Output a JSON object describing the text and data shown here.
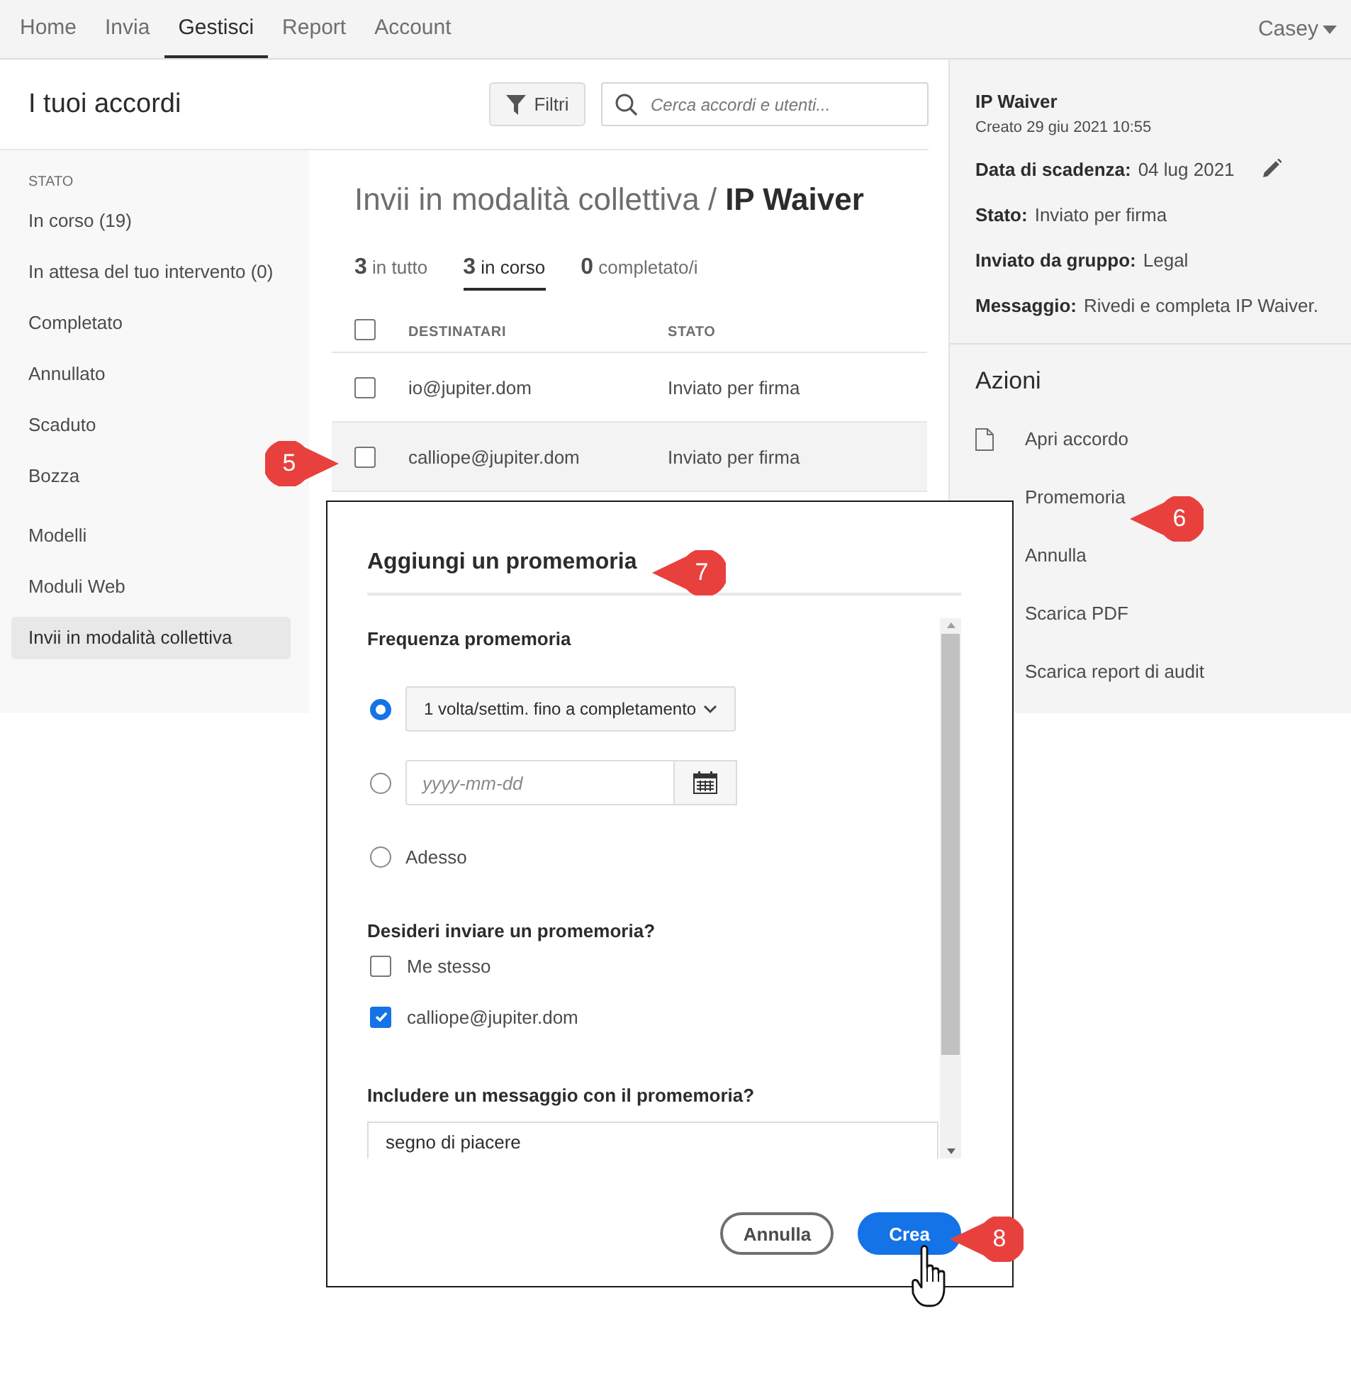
{
  "nav": {
    "items": [
      {
        "label": "Home",
        "selected": false
      },
      {
        "label": "Invia",
        "selected": false
      },
      {
        "label": "Gestisci",
        "selected": true
      },
      {
        "label": "Report",
        "selected": false
      },
      {
        "label": "Account",
        "selected": false
      }
    ],
    "user": "Casey"
  },
  "header": {
    "title": "I tuoi accordi",
    "filter_button": "Filtri",
    "search": {
      "placeholder": "Cerca accordi e utenti..."
    }
  },
  "sidebar": {
    "sections": [
      {
        "heading": "STATO",
        "items": [
          {
            "label": "In corso (19)",
            "selected": false
          },
          {
            "label": "In attesa del tuo intervento (0)",
            "selected": false
          },
          {
            "label": "Completato",
            "selected": false
          },
          {
            "label": "Annullato",
            "selected": false
          },
          {
            "label": "Scaduto",
            "selected": false
          },
          {
            "label": "Bozza",
            "selected": false
          }
        ]
      },
      {
        "items": [
          {
            "label": "Modelli",
            "selected": false
          },
          {
            "label": "Moduli Web",
            "selected": false
          },
          {
            "label": "Invii in modalità collettiva",
            "selected": true
          }
        ]
      }
    ]
  },
  "content": {
    "breadcrumb": "Invii in modalità collettiva /",
    "title": "IP Waiver",
    "tabs": [
      {
        "count": "3",
        "label": "in tutto",
        "selected": false
      },
      {
        "count": "3",
        "label": "in corso",
        "selected": true
      },
      {
        "count": "0",
        "label": "completato/i",
        "selected": false
      }
    ],
    "table": {
      "header_checked": false,
      "columns": [
        "DESTINATARI",
        "STATO"
      ],
      "rows": [
        {
          "checked": false,
          "selected": false,
          "cells": [
            "io@jupiter.dom",
            "Inviato per firma"
          ]
        },
        {
          "checked": false,
          "selected": true,
          "cells": [
            "calliope@jupiter.dom",
            "Inviato per firma"
          ]
        }
      ]
    }
  },
  "details": {
    "title": "IP Waiver",
    "created": "Creato 29 giu 2021 10:55",
    "fields": [
      {
        "label": "Data di scadenza:",
        "value": "04 lug 2021",
        "editable": true
      },
      {
        "label": "Stato:",
        "value": "Inviato per firma",
        "editable": false
      },
      {
        "label": "Inviato da gruppo:",
        "value": "Legal",
        "editable": false
      },
      {
        "label": "Messaggio:",
        "value": "Rivedi e completa IP Waiver.",
        "editable": false
      }
    ]
  },
  "actions": {
    "title": "Azioni",
    "items": [
      {
        "label": "Apri accordo",
        "kind": "document"
      },
      {
        "label": "Promemoria",
        "kind": "plain"
      },
      {
        "label": "Annulla",
        "kind": "plain"
      },
      {
        "label": "Scarica PDF",
        "kind": "plain"
      },
      {
        "label": "Scarica report di audit",
        "kind": "plain"
      }
    ]
  },
  "dialog": {
    "title": "Aggiungi un promemoria",
    "frequency": {
      "label": "Frequenza promemoria",
      "options": [
        {
          "kind": "select",
          "selected": true,
          "value": "1 volta/settim. fino a completamento"
        },
        {
          "kind": "date",
          "selected": false,
          "placeholder": "yyyy-mm-dd"
        },
        {
          "kind": "text",
          "selected": false,
          "label": "Adesso"
        }
      ]
    },
    "recipients": {
      "label": "Desideri inviare un promemoria?",
      "items": [
        {
          "label": "Me stesso",
          "checked": false
        },
        {
          "label": "calliope@jupiter.dom",
          "checked": true
        }
      ]
    },
    "message": {
      "label": "Includere un messaggio con il promemoria?",
      "value": "segno di piacere"
    },
    "buttons": [
      {
        "label": "Annulla",
        "kind": "secondary"
      },
      {
        "label": "Crea",
        "kind": "primary"
      }
    ]
  },
  "callouts": [
    {
      "number": "5"
    },
    {
      "number": "6"
    },
    {
      "number": "7"
    },
    {
      "number": "8"
    }
  ]
}
